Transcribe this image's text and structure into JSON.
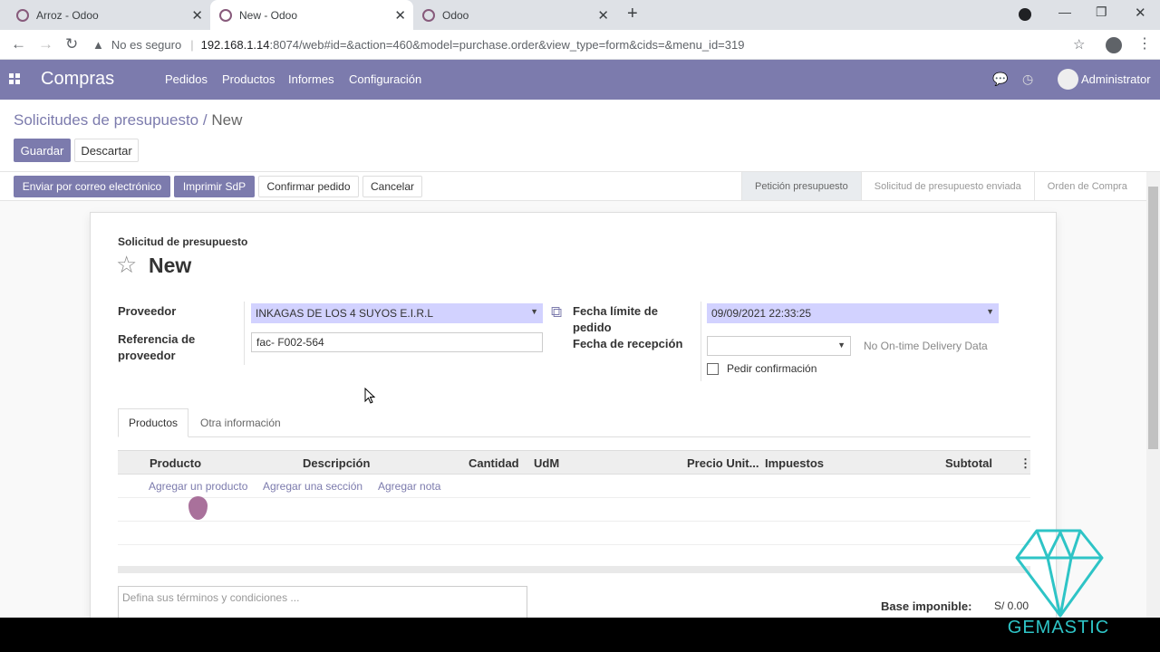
{
  "browser": {
    "tabs": [
      {
        "title": "Arroz - Odoo"
      },
      {
        "title": "New - Odoo"
      },
      {
        "title": "Odoo"
      }
    ],
    "address": {
      "security": "No es seguro",
      "host": "192.168.1.14",
      "path": ":8074/web#id=&action=460&model=purchase.order&view_type=form&cids=&menu_id=319"
    }
  },
  "nav": {
    "brand": "Compras",
    "menu": [
      "Pedidos",
      "Productos",
      "Informes",
      "Configuración"
    ],
    "user": "Administrator"
  },
  "breadcrumb": {
    "parent": "Solicitudes de presupuesto",
    "sep": "/",
    "current": "New"
  },
  "actions": {
    "save": "Guardar",
    "discard": "Descartar"
  },
  "statusbar": {
    "buttons": [
      "Enviar por correo electrónico",
      "Imprimir SdP",
      "Confirmar pedido",
      "Cancelar"
    ],
    "stages": [
      "Petición presupuesto",
      "Solicitud de presupuesto enviada",
      "Orden de Compra"
    ]
  },
  "form": {
    "subtitle": "Solicitud de presupuesto",
    "name": "New",
    "vendor_label": "Proveedor",
    "vendor_value": "INKAGAS DE LOS 4 SUYOS E.I.R.L",
    "ref_label_1": "Referencia de",
    "ref_label_2": "proveedor",
    "ref_value": "fac- F002-564",
    "deadline_label_1": "Fecha límite de",
    "deadline_label_2": "pedido",
    "deadline_value": "09/09/2021 22:33:25",
    "receipt_label": "Fecha de recepción",
    "receipt_value": "",
    "delivery_note": "No On-time Delivery Data",
    "ask_confirm_label": "Pedir confirmación",
    "tabs": [
      "Productos",
      "Otra información"
    ],
    "columns": [
      "Producto",
      "Descripción",
      "Cantidad",
      "UdM",
      "Precio Unit...",
      "Impuestos",
      "Subtotal"
    ],
    "add_links": [
      "Agregar un producto",
      "Agregar una sección",
      "Agregar nota"
    ],
    "terms_placeholder": "Defina sus términos y condiciones ...",
    "base_label": "Base imponible:",
    "base_value": "S/ 0.00"
  },
  "watermark": {
    "text": "GEMASTIC"
  },
  "colors": {
    "primary": "#7c7bad",
    "odoo_purple": "#875a7b",
    "required_bg": "#d2d2ff",
    "gem": "#2ec4c6"
  }
}
